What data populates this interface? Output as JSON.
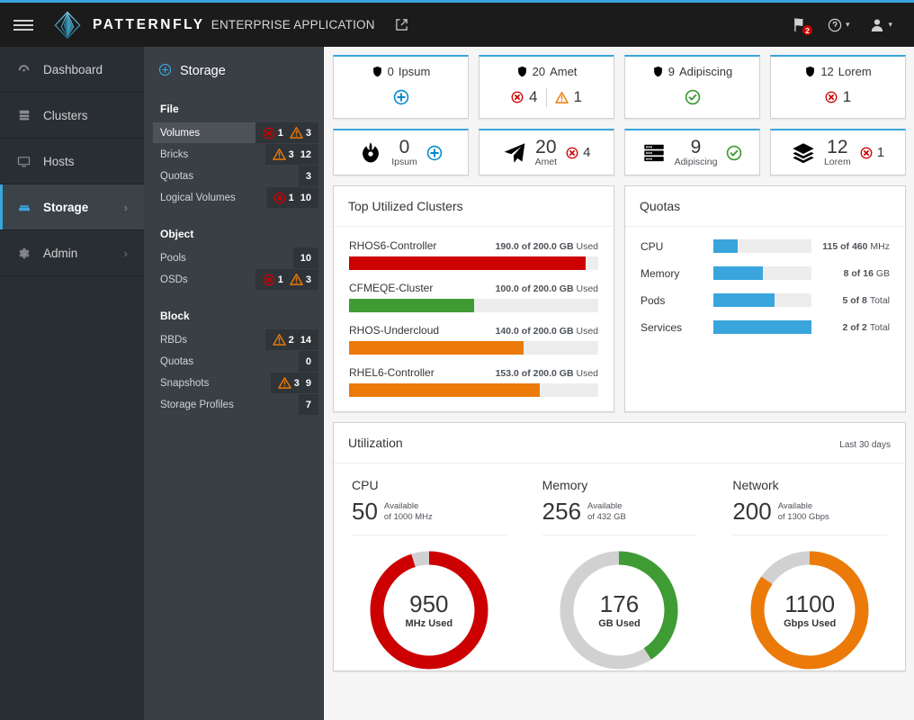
{
  "masthead": {
    "brand_bold": "PATTERNFLY",
    "brand_light": "ENTERPRISE APPLICATION",
    "notification_badge": "2",
    "accent_color": "#39a5dc"
  },
  "primary_nav": {
    "items": [
      {
        "label": "Dashboard",
        "icon": "dashboard-icon",
        "active": false,
        "caret": ""
      },
      {
        "label": "Clusters",
        "icon": "cluster-icon",
        "active": false,
        "caret": ""
      },
      {
        "label": "Hosts",
        "icon": "monitor-icon",
        "active": false,
        "caret": ""
      },
      {
        "label": "Storage",
        "icon": "storage-icon",
        "active": true,
        "caret": "›"
      },
      {
        "label": "Admin",
        "icon": "gear-icon",
        "active": false,
        "caret": "›"
      }
    ]
  },
  "secondary_nav": {
    "title": "Storage",
    "groups": [
      {
        "title": "File",
        "items": [
          {
            "label": "Volumes",
            "selected": true,
            "errors": "1",
            "warnings": "3",
            "count": ""
          },
          {
            "label": "Bricks",
            "selected": false,
            "errors": "",
            "warnings": "3",
            "count": "12"
          },
          {
            "label": "Quotas",
            "selected": false,
            "errors": "",
            "warnings": "",
            "count": "3"
          },
          {
            "label": "Logical Volumes",
            "selected": false,
            "errors": "1",
            "warnings": "",
            "count": "10"
          }
        ]
      },
      {
        "title": "Object",
        "items": [
          {
            "label": "Pools",
            "selected": false,
            "errors": "",
            "warnings": "",
            "count": "10"
          },
          {
            "label": "OSDs",
            "selected": false,
            "errors": "1",
            "warnings": "3",
            "count": ""
          }
        ]
      },
      {
        "title": "Block",
        "items": [
          {
            "label": "RBDs",
            "selected": false,
            "errors": "",
            "warnings": "2",
            "count": "14"
          },
          {
            "label": "Quotas",
            "selected": false,
            "errors": "",
            "warnings": "",
            "count": "0"
          },
          {
            "label": "Snapshots",
            "selected": false,
            "errors": "",
            "warnings": "3",
            "count": "9"
          },
          {
            "label": "Storage Profiles",
            "selected": false,
            "errors": "",
            "warnings": "",
            "count": "7"
          }
        ]
      }
    ]
  },
  "aggregate_cards": [
    {
      "count": "0",
      "label": "Ipsum",
      "icon": "shield-icon",
      "statuses": [
        {
          "type": "add",
          "value": ""
        }
      ]
    },
    {
      "count": "20",
      "label": "Amet",
      "icon": "shield-icon",
      "statuses": [
        {
          "type": "error",
          "value": "4"
        },
        {
          "type": "warning",
          "value": "1"
        }
      ]
    },
    {
      "count": "9",
      "label": "Adipiscing",
      "icon": "shield-icon",
      "statuses": [
        {
          "type": "ok",
          "value": ""
        }
      ]
    },
    {
      "count": "12",
      "label": "Lorem",
      "icon": "shield-icon",
      "statuses": [
        {
          "type": "error",
          "value": "1"
        }
      ]
    }
  ],
  "mini_cards": [
    {
      "count": "0",
      "label": "Ipsum",
      "icon": "rebel-icon",
      "statuses": [
        {
          "type": "add",
          "value": ""
        }
      ]
    },
    {
      "count": "20",
      "label": "Amet",
      "icon": "paper-plane-icon",
      "statuses": [
        {
          "type": "error",
          "value": "4"
        }
      ]
    },
    {
      "count": "9",
      "label": "Adipiscing",
      "icon": "server-icon",
      "statuses": [
        {
          "type": "ok",
          "value": ""
        }
      ]
    },
    {
      "count": "12",
      "label": "Lorem",
      "icon": "layers-icon",
      "statuses": [
        {
          "type": "error",
          "value": "1"
        }
      ]
    }
  ],
  "top_clusters": {
    "title": "Top Utilized Clusters",
    "rows": [
      {
        "name": "RHOS6-Controller",
        "used": "190.0",
        "total": "200.0",
        "unit": "GB",
        "suffix": "Used",
        "value_text": "190.0 of 200.0 GB",
        "percent": 95,
        "color": "#cc0000"
      },
      {
        "name": "CFMEQE-Cluster",
        "used": "100.0",
        "total": "200.0",
        "unit": "GB",
        "suffix": "Used",
        "value_text": "100.0 of 200.0 GB",
        "percent": 50,
        "color": "#3f9c35"
      },
      {
        "name": "RHOS-Undercloud",
        "used": "140.0",
        "total": "200.0",
        "unit": "GB",
        "suffix": "Used",
        "value_text": "140.0 of 200.0 GB",
        "percent": 70,
        "color": "#ec7a08"
      },
      {
        "name": "RHEL6-Controller",
        "used": "153.0",
        "total": "200.0",
        "unit": "GB",
        "suffix": "Used",
        "value_text": "153.0 of 200.0 GB",
        "percent": 76.5,
        "color": "#ec7a08"
      }
    ]
  },
  "quotas": {
    "title": "Quotas",
    "rows": [
      {
        "name": "CPU",
        "value_text": "115 of 460",
        "unit": "MHz",
        "percent": 25
      },
      {
        "name": "Memory",
        "value_text": "8 of 16",
        "unit": "GB",
        "percent": 50
      },
      {
        "name": "Pods",
        "value_text": "5 of 8",
        "unit": "Total",
        "percent": 62.5
      },
      {
        "name": "Services",
        "value_text": "2 of 2",
        "unit": "Total",
        "percent": 100
      }
    ]
  },
  "utilization": {
    "title": "Utilization",
    "period": "Last 30 days",
    "columns": [
      {
        "title": "CPU",
        "available": "50",
        "available_label": "Available",
        "of_label": "of 1000 MHz",
        "used": "950",
        "used_unit": "MHz Used",
        "percent": 95,
        "color": "#cc0000",
        "total": 1000
      },
      {
        "title": "Memory",
        "available": "256",
        "available_label": "Available",
        "of_label": "of 432 GB",
        "used": "176",
        "used_unit": "GB Used",
        "percent": 40.7,
        "color": "#3f9c35",
        "total": 432
      },
      {
        "title": "Network",
        "available": "200",
        "available_label": "Available",
        "of_label": "of 1300 Gbps",
        "used": "1100",
        "used_unit": "Gbps Used",
        "percent": 84.6,
        "color": "#ec7a08",
        "total": 1300
      }
    ]
  },
  "chart_data": [
    {
      "type": "bar",
      "title": "Top Utilized Clusters",
      "categories": [
        "RHOS6-Controller",
        "CFMEQE-Cluster",
        "RHOS-Undercloud",
        "RHEL6-Controller"
      ],
      "values": [
        190.0,
        100.0,
        140.0,
        153.0
      ],
      "max": 200.0,
      "unit": "GB",
      "colors": [
        "#cc0000",
        "#3f9c35",
        "#ec7a08",
        "#ec7a08"
      ],
      "xlabel": "",
      "ylabel": "Used",
      "ylim": [
        0,
        200
      ]
    },
    {
      "type": "bar",
      "title": "Quotas",
      "categories": [
        "CPU",
        "Memory",
        "Pods",
        "Services"
      ],
      "values": [
        115,
        8,
        5,
        2
      ],
      "maxima": [
        460,
        16,
        8,
        2
      ],
      "units": [
        "MHz",
        "GB",
        "Total",
        "Total"
      ],
      "colors": [
        "#39a5dc",
        "#39a5dc",
        "#39a5dc",
        "#39a5dc"
      ]
    },
    {
      "type": "pie",
      "title": "Utilization - CPU",
      "labels": [
        "Used",
        "Available"
      ],
      "values": [
        950,
        50
      ],
      "unit": "MHz",
      "colors": [
        "#cc0000",
        "#d1d1d1"
      ]
    },
    {
      "type": "pie",
      "title": "Utilization - Memory",
      "labels": [
        "Used",
        "Available"
      ],
      "values": [
        176,
        256
      ],
      "unit": "GB",
      "colors": [
        "#3f9c35",
        "#d1d1d1"
      ]
    },
    {
      "type": "pie",
      "title": "Utilization - Network",
      "labels": [
        "Used",
        "Available"
      ],
      "values": [
        1100,
        200
      ],
      "unit": "Gbps",
      "colors": [
        "#ec7a08",
        "#d1d1d1"
      ]
    }
  ]
}
